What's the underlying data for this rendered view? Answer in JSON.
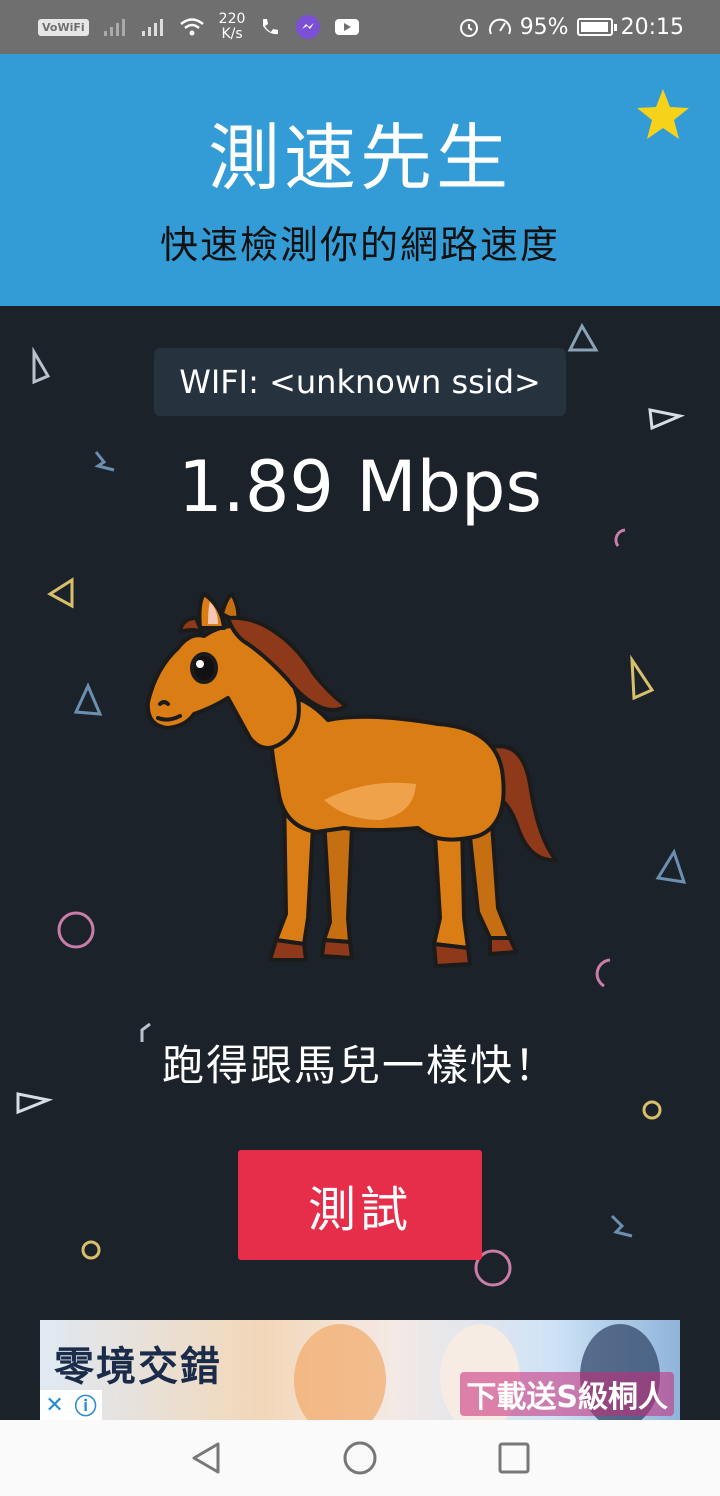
{
  "status_bar": {
    "network_badge": "VoWiFi",
    "net_speed_value": "220",
    "net_speed_unit": "K/s",
    "battery": "95%",
    "time": "20:15"
  },
  "header": {
    "title": "測速先生",
    "subtitle": "快速檢測你的網路速度",
    "favorite_icon": "star-icon"
  },
  "main": {
    "wifi_label": "WIFI: <unknown ssid>",
    "speed": "1.89 Mbps",
    "mascot": "horse",
    "tagline": "跑得跟馬兒一樣快！",
    "test_button": "測試"
  },
  "ad": {
    "title": "零境交錯",
    "promo": "下載送S級桐人",
    "close_icon": "close-icon",
    "info_icon": "info-icon"
  },
  "colors": {
    "header_bg": "#339cd6",
    "main_bg": "#1c222a",
    "button": "#e62d4a",
    "star": "#f7d21a",
    "horse_body": "#d97d14",
    "horse_mane": "#8e3a1a"
  },
  "nav": {
    "back_icon": "back-triangle-icon",
    "home_icon": "home-circle-icon",
    "recents_icon": "recents-square-icon"
  }
}
